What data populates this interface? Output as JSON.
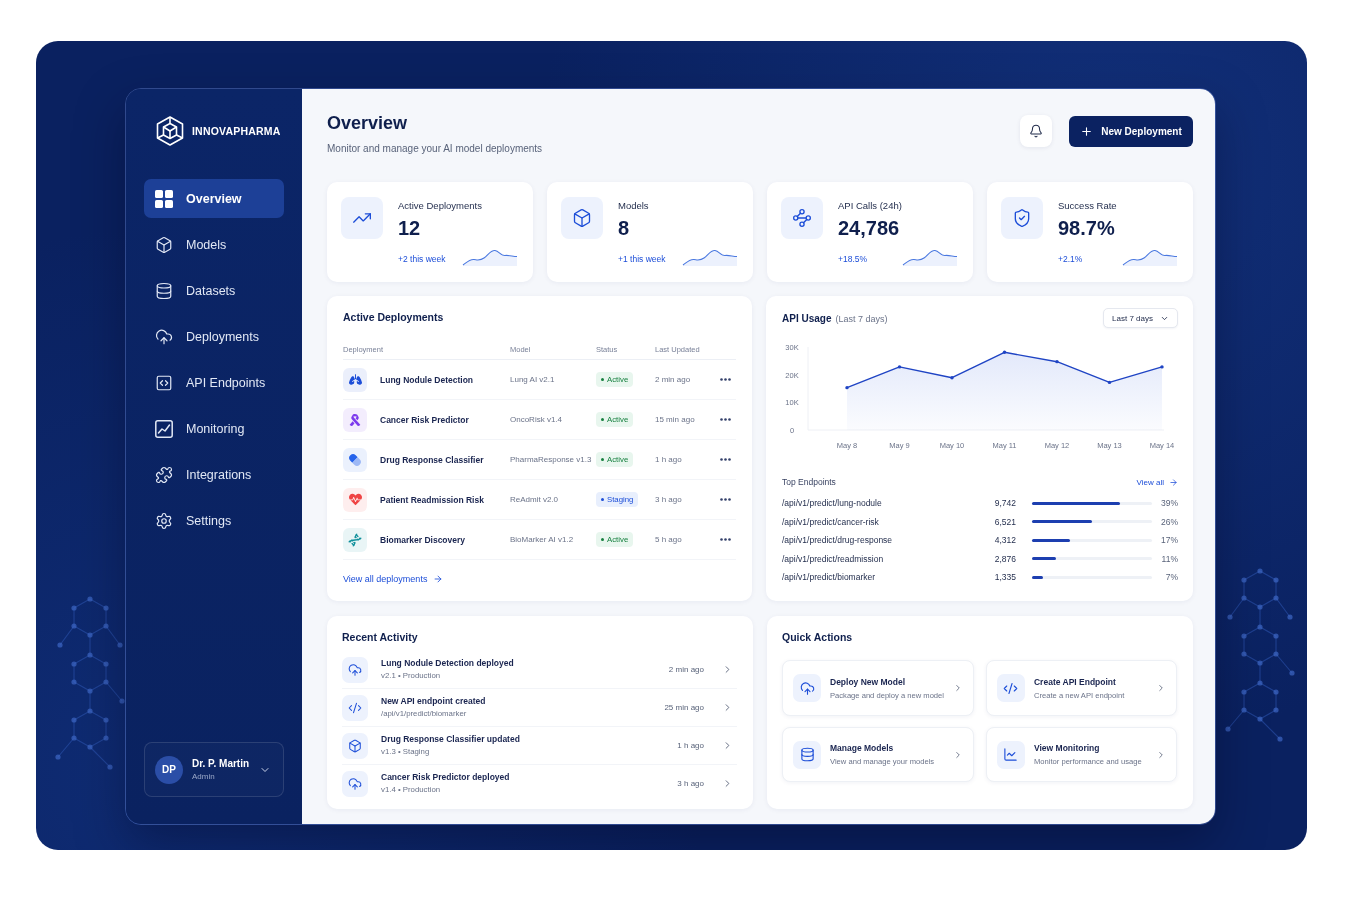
{
  "sidebar": {
    "brand": "INNOVAPHARMA",
    "nav": [
      {
        "label": "Overview",
        "selected": true
      },
      {
        "label": "Models",
        "selected": false
      },
      {
        "label": "Datasets",
        "selected": false
      },
      {
        "label": "Deployments",
        "selected": false
      },
      {
        "label": "API Endpoints",
        "selected": false
      },
      {
        "label": "Monitoring",
        "selected": false
      },
      {
        "label": "Integrations",
        "selected": false
      },
      {
        "label": "Settings",
        "selected": false
      }
    ],
    "user": {
      "initials": "DP",
      "name": "Dr. P. Martin",
      "role": "Admin"
    }
  },
  "header": {
    "title": "Overview",
    "subtitle": "Monitor and manage your AI model deployments",
    "primary_button": "New Deployment"
  },
  "stats": [
    {
      "label": "Active Deployments",
      "value": "12",
      "change": "+2 this week"
    },
    {
      "label": "Models",
      "value": "8",
      "change": "+1 this week"
    },
    {
      "label": "API Calls (24h)",
      "value": "24,786",
      "change": "+18.5%"
    },
    {
      "label": "Success Rate",
      "value": "98.7%",
      "change": "+2.1%"
    }
  ],
  "deployments": {
    "title": "Active Deployments",
    "columns": [
      "Deployment",
      "Model",
      "Status",
      "Last Updated"
    ],
    "rows": [
      {
        "name": "Lung Nodule Detection",
        "model": "Lung AI v2.1",
        "status": {
          "label": "Active",
          "kind": "active"
        },
        "updated": "2 min ago",
        "color": "#1d4ed8"
      },
      {
        "name": "Cancer Risk Predictor",
        "model": "OncoRisk v1.4",
        "status": {
          "label": "Active",
          "kind": "active"
        },
        "updated": "15 min ago",
        "color": "#7c3aed"
      },
      {
        "name": "Drug Response Classifier",
        "model": "PharmaResponse v1.3",
        "status": {
          "label": "Active",
          "kind": "active"
        },
        "updated": "1 h ago",
        "color": "#2563eb"
      },
      {
        "name": "Patient Readmission Risk",
        "model": "ReAdmit v2.0",
        "status": {
          "label": "Staging",
          "kind": "staging"
        },
        "updated": "3 h ago",
        "color": "#ef4444"
      },
      {
        "name": "Biomarker Discovery",
        "model": "BioMarker AI v1.2",
        "status": {
          "label": "Active",
          "kind": "active"
        },
        "updated": "5 h ago",
        "color": "#0e8f9a"
      }
    ],
    "link": "View all deployments"
  },
  "api_usage": {
    "title": "API Usage",
    "subtitle": "(Last 7 days)",
    "range": "Last 7 days",
    "chart_data": {
      "type": "area",
      "categories": [
        "May 8",
        "May 9",
        "May 10",
        "May 11",
        "May 12",
        "May 13",
        "May 14"
      ],
      "series": [
        {
          "color": "#1f44c4",
          "values": [
            15300,
            22800,
            18900,
            28100,
            24700,
            17200,
            22800
          ]
        }
      ],
      "ylim": [
        0,
        30000
      ],
      "yticks": [
        {
          "value": 0,
          "label": "0"
        },
        {
          "value": 10000,
          "label": "10K"
        },
        {
          "value": 20000,
          "label": "20K"
        },
        {
          "value": 30000,
          "label": "30K"
        }
      ]
    },
    "endpoints_title": "Top Endpoints",
    "view_all": "View all",
    "endpoints": [
      {
        "path": "/api/v1/predict/lung-nodule",
        "count": "9,742",
        "level": 0.73,
        "share": "39%"
      },
      {
        "path": "/api/v1/predict/cancer-risk",
        "count": "6,521",
        "level": 0.5,
        "share": "26%"
      },
      {
        "path": "/api/v1/predict/drug-response",
        "count": "4,312",
        "level": 0.32,
        "share": "17%"
      },
      {
        "path": "/api/v1/predict/readmission",
        "count": "2,876",
        "level": 0.2,
        "share": "11%"
      },
      {
        "path": "/api/v1/predict/biomarker",
        "count": "1,335",
        "level": 0.09,
        "share": "7%"
      }
    ]
  },
  "activity": {
    "title": "Recent Activity",
    "items": [
      {
        "kind": "deploy",
        "title": "Lung Nodule Detection deployed",
        "detail": "v2.1 • Production",
        "time": "2 min ago"
      },
      {
        "kind": "endpoint",
        "title": "New API endpoint created",
        "detail": "/api/v1/predict/biomarker",
        "time": "25 min ago"
      },
      {
        "kind": "update",
        "title": "Drug Response Classifier updated",
        "detail": "v1.3 • Staging",
        "time": "1 h ago"
      },
      {
        "kind": "deploy",
        "title": "Cancer Risk Predictor deployed",
        "detail": "v1.4 • Production",
        "time": "3 h ago"
      }
    ]
  },
  "quick_actions": {
    "title": "Quick Actions",
    "items": [
      {
        "kind": "deploy",
        "title": "Deploy New Model",
        "description": "Package and deploy a new model"
      },
      {
        "kind": "endpoint",
        "title": "Create API Endpoint",
        "description": "Create a new API endpoint"
      },
      {
        "kind": "models",
        "title": "Manage Models",
        "description": "View and manage your models"
      },
      {
        "kind": "monitoring",
        "title": "View Monitoring",
        "description": "Monitor performance and usage"
      }
    ]
  }
}
